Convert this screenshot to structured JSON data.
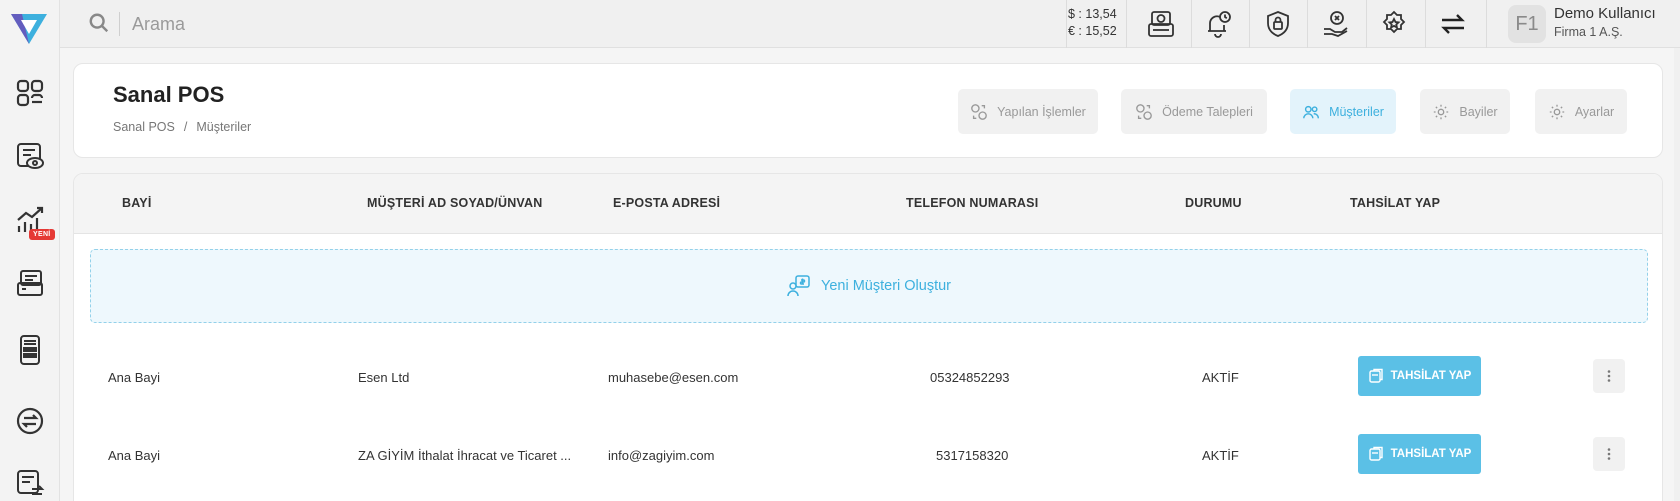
{
  "colors": {
    "accent": "#3db0de",
    "button": "#5bc0e6",
    "badge": "#e53935"
  },
  "sidebar": {
    "new_badge": "YENİ",
    "items": [
      {
        "icon": "dashboard-icon"
      },
      {
        "icon": "list-view-icon"
      },
      {
        "icon": "growth-chart-icon"
      },
      {
        "icon": "pos-terminal-icon"
      },
      {
        "icon": "calculator-pos-icon"
      },
      {
        "icon": "transfer-icon"
      },
      {
        "icon": "list-transfer-icon"
      }
    ]
  },
  "topbar": {
    "search_placeholder": "Arama",
    "usd_rate": "$ : 13,54",
    "eur_rate": "€ : 15,52",
    "avatar_initials": "F1",
    "user_name": "Demo Kullanıcı",
    "user_company": "Firma 1 A.Ş."
  },
  "header": {
    "title": "Sanal POS",
    "breadcrumb": [
      "Sanal POS",
      "/",
      "Müşteriler"
    ],
    "nav": [
      {
        "label": "Yapılan İşlemler",
        "icon": "exchange-coins-icon",
        "active": false
      },
      {
        "label": "Ödeme Talepleri",
        "icon": "payment-request-icon",
        "active": false
      },
      {
        "label": "Müşteriler",
        "icon": "users-icon",
        "active": true
      },
      {
        "label": "Bayiler",
        "icon": "gear-icon",
        "active": false
      },
      {
        "label": "Ayarlar",
        "icon": "gear-icon",
        "active": false
      }
    ]
  },
  "table": {
    "columns": [
      "BAYİ",
      "MÜŞTERİ AD SOYAD/ÜNVAN",
      "E-POSTA ADRESİ",
      "TELEFON NUMARASI",
      "DURUMU",
      "TAHSİLAT YAP"
    ],
    "create_label": "Yeni Müşteri Oluştur",
    "pay_label": "TAHSİLAT YAP",
    "rows": [
      {
        "bayi": "Ana Bayi",
        "customer": "Esen Ltd",
        "email": "muhasebe@esen.com",
        "phone": "05324852293",
        "status": "AKTİF"
      },
      {
        "bayi": "Ana Bayi",
        "customer": "ZA GİYİM İthalat İhracat ve Ticaret ...",
        "email": "info@zagiyim.com",
        "phone": "5317158320",
        "status": "AKTİF"
      }
    ]
  }
}
